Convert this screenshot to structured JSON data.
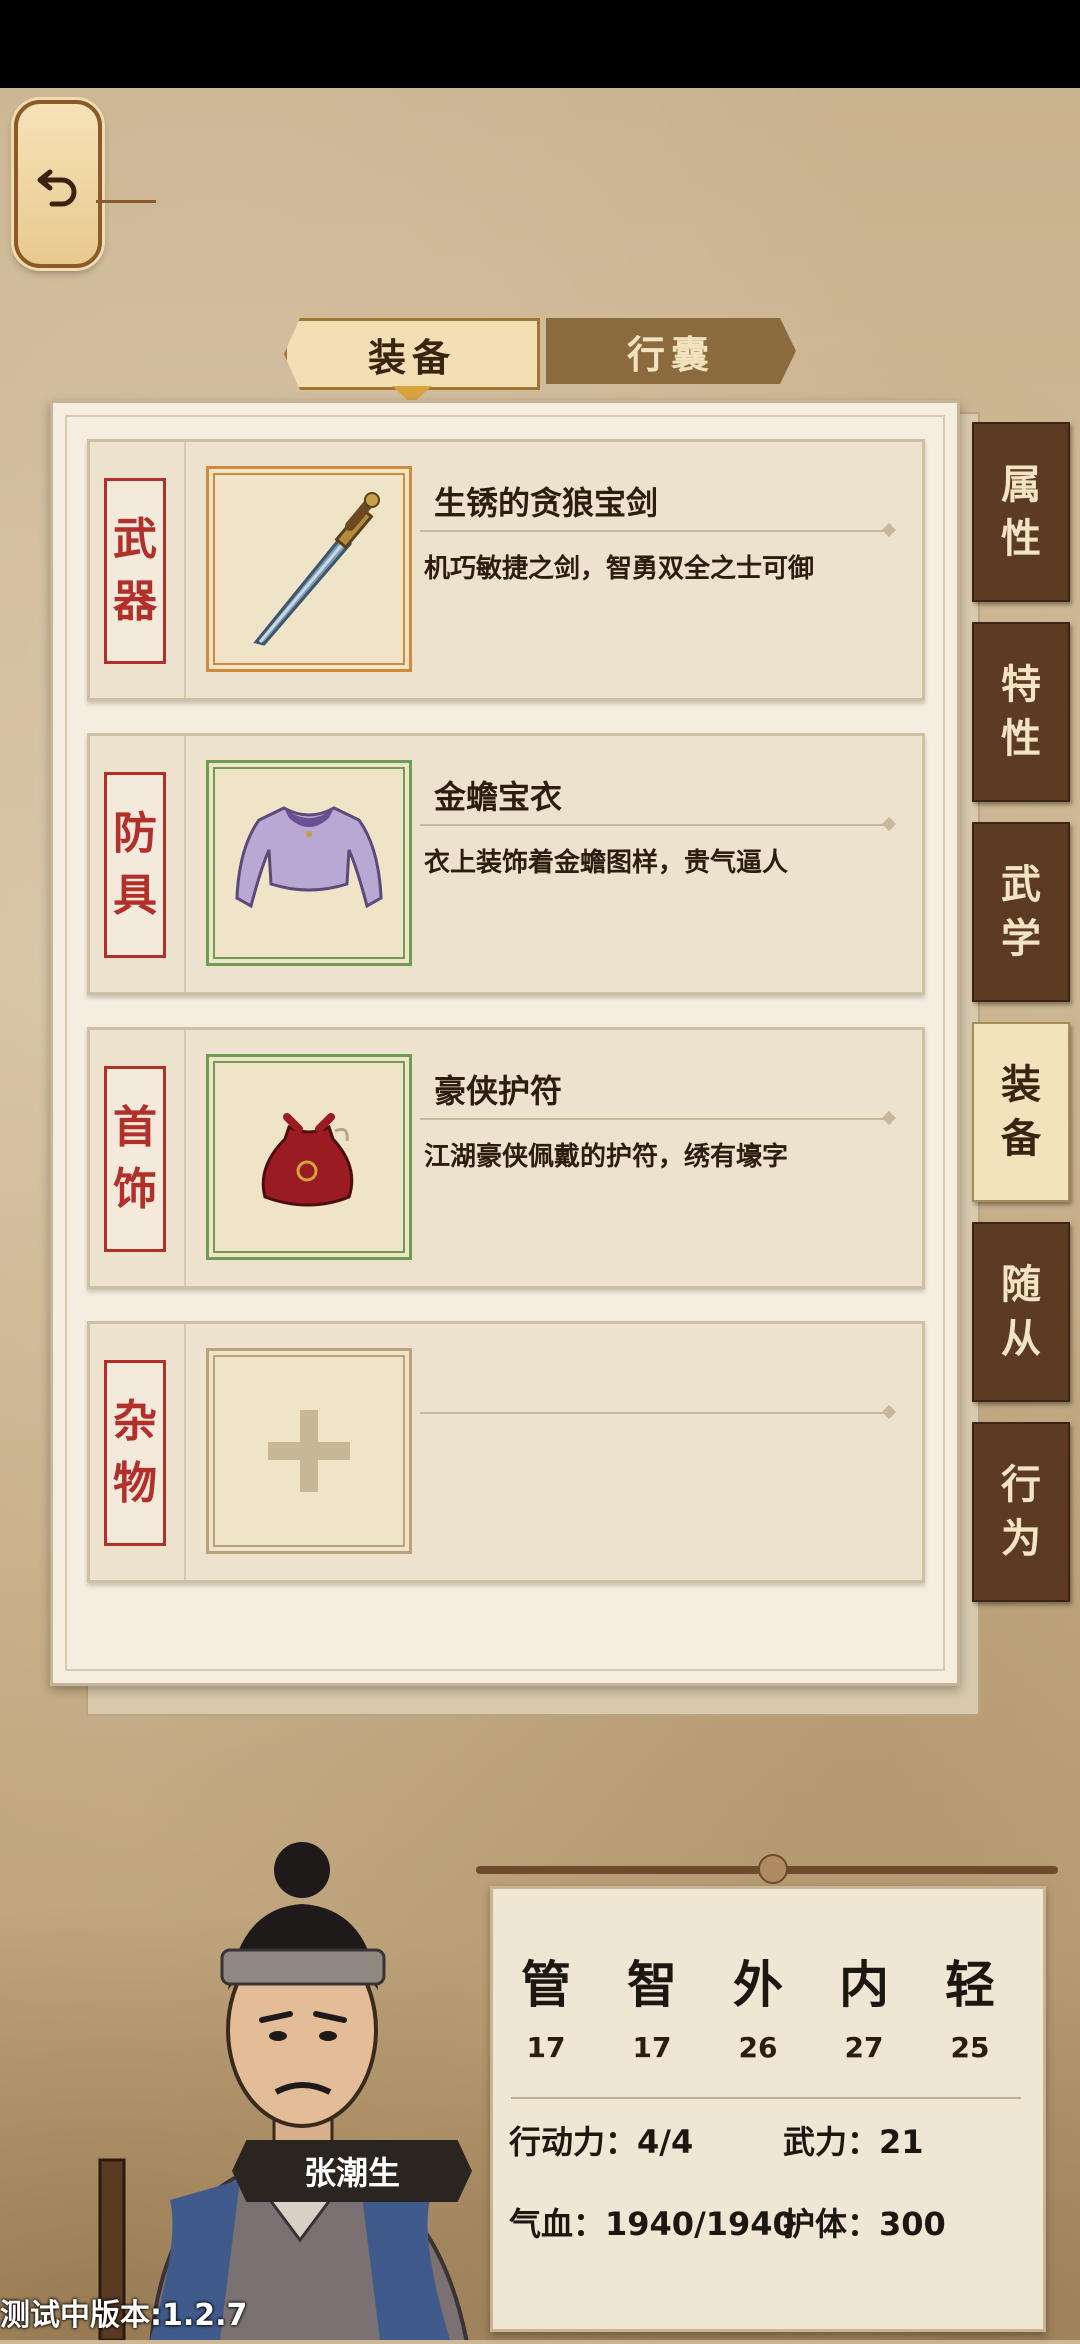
{
  "tabs": {
    "equipment": "装备",
    "bag": "行囊"
  },
  "slots": [
    {
      "label_top": "武",
      "label_bottom": "器",
      "name": "生锈的贪狼宝剑",
      "desc": "机巧敏捷之剑，智勇双全之士可御"
    },
    {
      "label_top": "防",
      "label_bottom": "具",
      "name": "金蟾宝衣",
      "desc": "衣上装饰着金蟾图样，贵气逼人"
    },
    {
      "label_top": "首",
      "label_bottom": "饰",
      "name": "豪侠护符",
      "desc": "江湖豪侠佩戴的护符，绣有壕字"
    },
    {
      "label_top": "杂",
      "label_bottom": "物",
      "name": "",
      "desc": ""
    }
  ],
  "side_tabs": [
    {
      "top": "属",
      "bottom": "性"
    },
    {
      "top": "特",
      "bottom": "性"
    },
    {
      "top": "武",
      "bottom": "学"
    },
    {
      "top": "装",
      "bottom": "备"
    },
    {
      "top": "随",
      "bottom": "从"
    },
    {
      "top": "行",
      "bottom": "为"
    }
  ],
  "character": {
    "name": "张潮生"
  },
  "stats": {
    "attributes": [
      {
        "char": "管",
        "value": "17"
      },
      {
        "char": "智",
        "value": "17"
      },
      {
        "char": "外",
        "value": "26"
      },
      {
        "char": "内",
        "value": "27"
      },
      {
        "char": "轻",
        "value": "25"
      }
    ],
    "action_power": "行动力：4/4",
    "martial_power": "武力：21",
    "hp": "气血：1940/1940",
    "guard": "护体：300"
  },
  "version": "测试中版本:1.2.7",
  "colors": {
    "seal_red": "#b3302a",
    "side_tab_brown": "#5d3a22",
    "frame_orange": "#d08a3c",
    "frame_green": "#6e9c52"
  }
}
